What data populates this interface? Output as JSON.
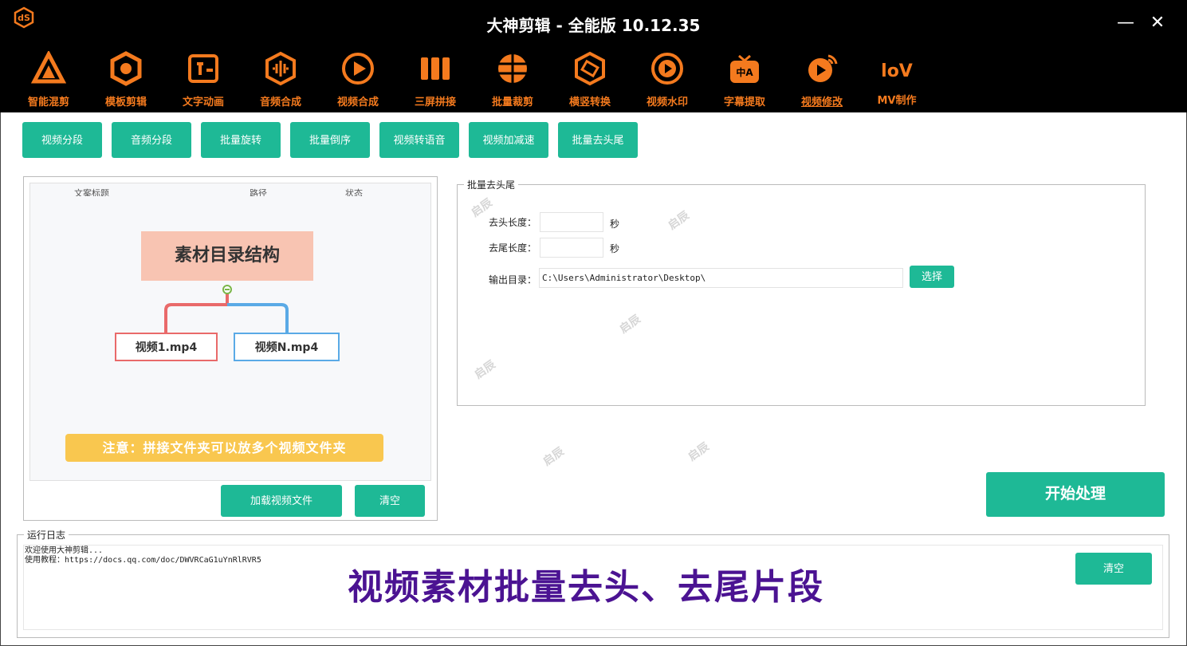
{
  "window": {
    "title": "大神剪辑 - 全能版 10.12.35",
    "minimize_glyph": "—",
    "close_glyph": "✕"
  },
  "toolbar": [
    {
      "label": "智能混剪",
      "icon": "smart-mix-icon"
    },
    {
      "label": "模板剪辑",
      "icon": "template-edit-icon"
    },
    {
      "label": "文字动画",
      "icon": "text-animation-icon"
    },
    {
      "label": "音频合成",
      "icon": "audio-merge-icon"
    },
    {
      "label": "视频合成",
      "icon": "video-merge-icon"
    },
    {
      "label": "三屏拼接",
      "icon": "triple-screen-icon"
    },
    {
      "label": "批量裁剪",
      "icon": "batch-crop-icon"
    },
    {
      "label": "横竖转换",
      "icon": "orientation-icon"
    },
    {
      "label": "视频水印",
      "icon": "watermark-icon"
    },
    {
      "label": "字幕提取",
      "icon": "subtitle-extract-icon"
    },
    {
      "label": "视频修改",
      "icon": "video-modify-icon",
      "active": true
    },
    {
      "label": "MV制作",
      "icon": "mv-icon"
    }
  ],
  "subtabs": [
    "视频分段",
    "音频分段",
    "批量旋转",
    "批量倒序",
    "视频转语音",
    "视频加减速",
    "批量去头尾"
  ],
  "file_list": {
    "columns": [
      "文案标题",
      "路径",
      "状态"
    ],
    "mindmap": {
      "root": "素材目录结构",
      "children": [
        "视频1.mp4",
        "视频N.mp4"
      ]
    },
    "note": "注意：拼接文件夹可以放多个视频文件夹",
    "load_button": "加载视频文件",
    "clear_button": "清空"
  },
  "settings": {
    "group_title": "批量去头尾",
    "head_label": "去头长度：",
    "head_value": "",
    "head_unit": "秒",
    "tail_label": "去尾长度：",
    "tail_value": "",
    "tail_unit": "秒",
    "output_label": "输出目录：",
    "output_value": "C:\\Users\\Administrator\\Desktop\\",
    "choose_button": "选择"
  },
  "start_button": "开始处理",
  "log": {
    "title": "运行日志",
    "lines": [
      "欢迎使用大神剪辑...",
      "使用教程：https://docs.qq.com/doc/DWVRCaG1uYnRlRVR5"
    ],
    "clear_button": "清空",
    "caption": "视频素材批量去头、去尾片段"
  },
  "watermark_text": "启辰",
  "colors": {
    "accent": "#1eb996",
    "toolbar_text": "#f47a1e",
    "caption": "#4b1392"
  }
}
